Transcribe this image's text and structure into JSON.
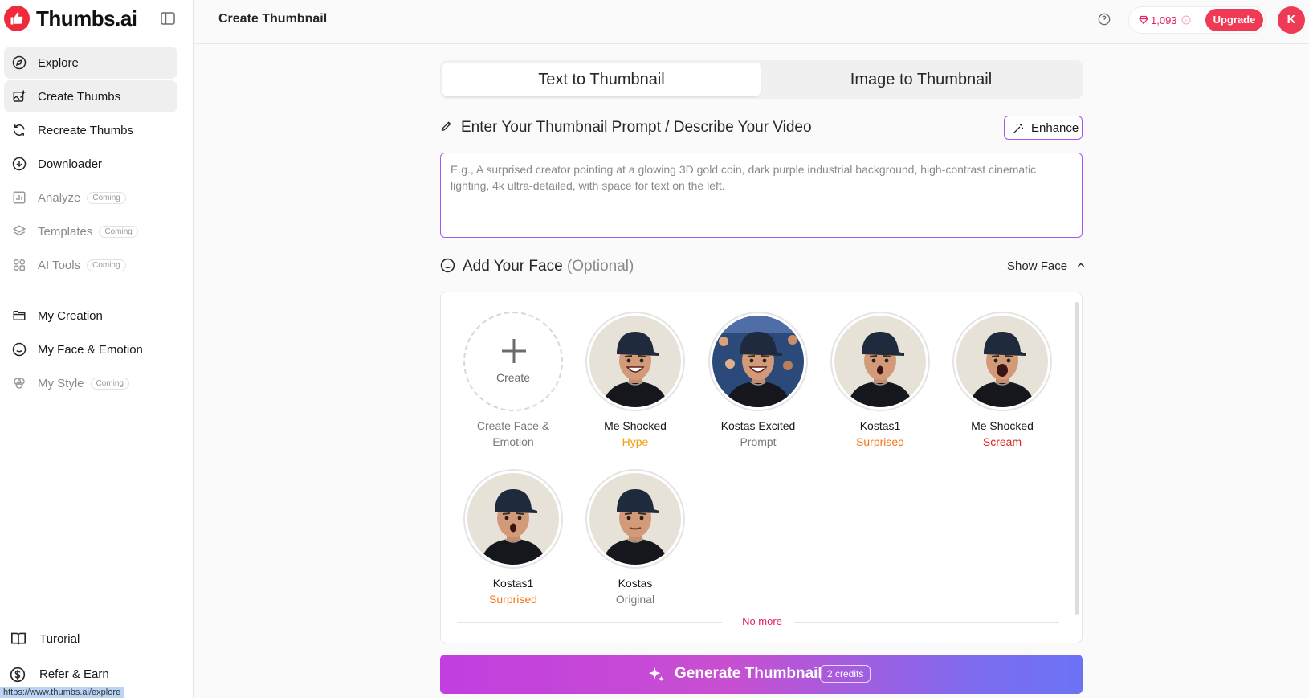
{
  "app": {
    "name": "Thumbs.ai",
    "colors": {
      "brand": "#ef2a3b",
      "accent": "#a855f7",
      "danger": "#e0245e"
    }
  },
  "sidebar": {
    "coming_label": "Coming",
    "items": [
      {
        "label": "Explore",
        "icon": "compass-icon",
        "state": "hover"
      },
      {
        "label": "Create Thumbs",
        "icon": "image-plus-icon",
        "state": "active"
      },
      {
        "label": "Recreate Thumbs",
        "icon": "refresh-icon"
      },
      {
        "label": "Downloader",
        "icon": "download-icon"
      },
      {
        "label": "Analyze",
        "icon": "bar-chart-icon",
        "coming": true
      },
      {
        "label": "Templates",
        "icon": "layers-icon",
        "coming": true
      },
      {
        "label": "AI Tools",
        "icon": "grid-icon",
        "coming": true
      },
      {
        "label": "My Creation",
        "icon": "folder-icon"
      },
      {
        "label": "My Face & Emotion",
        "icon": "face-icon"
      },
      {
        "label": "My Style",
        "icon": "palette-icon",
        "coming": true
      }
    ],
    "bottom": [
      {
        "label": "Turorial",
        "icon": "book-icon"
      },
      {
        "label": "Refer & Earn",
        "icon": "dollar-icon"
      }
    ],
    "status_url": "https://www.thumbs.ai/explore"
  },
  "header": {
    "title": "Create Thumbnail",
    "credits": "1,093",
    "upgrade_label": "Upgrade",
    "avatar_initial": "K"
  },
  "main": {
    "tabs": [
      {
        "label": "Text to Thumbnail",
        "active": true
      },
      {
        "label": "Image to Thumbnail",
        "active": false
      }
    ],
    "prompt": {
      "title": "Enter Your Thumbnail Prompt / Describe Your Video",
      "enhance_label": "Enhance",
      "placeholder": "E.g., A surprised creator pointing at a glowing 3D gold coin, dark purple industrial background, high-contrast cinematic lighting, 4k ultra-detailed, with space for text on the left.",
      "value": ""
    },
    "face": {
      "title": "Add Your Face",
      "optional": "(Optional)",
      "toggle_label": "Show Face",
      "create": {
        "circle_label": "Create",
        "name": "Create Face & Emotion"
      },
      "items": [
        {
          "name": "Me Shocked",
          "tag": "Hype",
          "tag_color": "#f59e0b",
          "mouth": "smile",
          "bg": "#e7e2d8"
        },
        {
          "name": "Kostas Excited",
          "tag": "Prompt",
          "tag_color": "#7a7a7a",
          "mouth": "smile",
          "bg": "#2b4a7a"
        },
        {
          "name": "Kostas1",
          "tag": "Surprised",
          "tag_color": "#f97316",
          "mouth": "o",
          "bg": "#e7e2d8"
        },
        {
          "name": "Me Shocked",
          "tag": "Scream",
          "tag_color": "#dc2626",
          "mouth": "scream",
          "bg": "#e7e2d8"
        },
        {
          "name": "Kostas1",
          "tag": "Surprised",
          "tag_color": "#f97316",
          "mouth": "o",
          "bg": "#e7e2d8"
        },
        {
          "name": "Kostas",
          "tag": "Original",
          "tag_color": "#7a7a7a",
          "mouth": "neutral",
          "bg": "#e7e2d8"
        }
      ],
      "no_more": "No more"
    },
    "generate": {
      "label": "Generate Thumbnail",
      "credits": "2 credits"
    }
  }
}
